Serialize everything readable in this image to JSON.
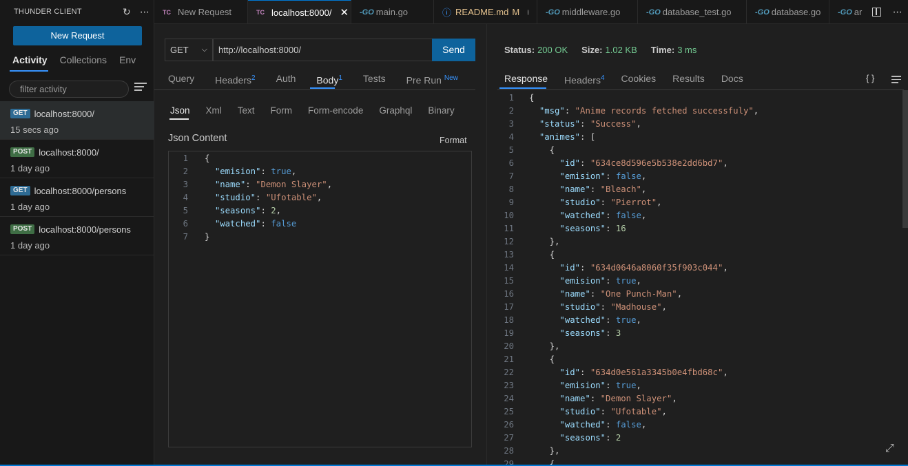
{
  "sidebar": {
    "title": "THUNDER CLIENT",
    "new_request_label": "New Request",
    "tabs": [
      "Activity",
      "Collections",
      "Env"
    ],
    "filter_placeholder": "filter activity",
    "activity": [
      {
        "method": "GET",
        "url": "localhost:8000/",
        "time": "15 secs ago"
      },
      {
        "method": "POST",
        "url": "localhost:8000/",
        "time": "1 day ago"
      },
      {
        "method": "GET",
        "url": "localhost:8000/persons",
        "time": "1 day ago"
      },
      {
        "method": "POST",
        "url": "localhost:8000/persons",
        "time": "1 day ago"
      }
    ]
  },
  "editor_tabs": [
    {
      "icon": "TC",
      "label": "New Request"
    },
    {
      "icon": "TC",
      "label": "localhost:8000/"
    },
    {
      "icon": "GO",
      "label": "main.go"
    },
    {
      "icon": "info",
      "label": "README.md",
      "status": "M"
    },
    {
      "icon": "GO",
      "label": "middleware.go"
    },
    {
      "icon": "GO",
      "label": "database_test.go"
    },
    {
      "icon": "GO",
      "label": "database.go"
    },
    {
      "icon": "GO",
      "label": "ar"
    }
  ],
  "request": {
    "method": "GET",
    "url": "http://localhost:8000/",
    "send_label": "Send",
    "tabs": {
      "query": "Query",
      "headers": "Headers",
      "headers_count": "2",
      "auth": "Auth",
      "body": "Body",
      "body_count": "1",
      "tests": "Tests",
      "prerun": "Pre Run",
      "prerun_badge": "New"
    },
    "body_tabs": [
      "Json",
      "Xml",
      "Text",
      "Form",
      "Form-encode",
      "Graphql",
      "Binary"
    ],
    "json_title": "Json Content",
    "format_label": "Format"
  },
  "response": {
    "status_label": "Status:",
    "status_value": "200 OK",
    "size_label": "Size:",
    "size_value": "1.02 KB",
    "time_label": "Time:",
    "time_value": "3 ms",
    "tabs": {
      "response": "Response",
      "headers": "Headers",
      "headers_count": "4",
      "cookies": "Cookies",
      "results": "Results",
      "docs": "Docs"
    },
    "braces_label": "{ }"
  },
  "colors": {
    "accent": "#0e639c",
    "success": "#73c991",
    "tab_underline": "#3794ff"
  }
}
